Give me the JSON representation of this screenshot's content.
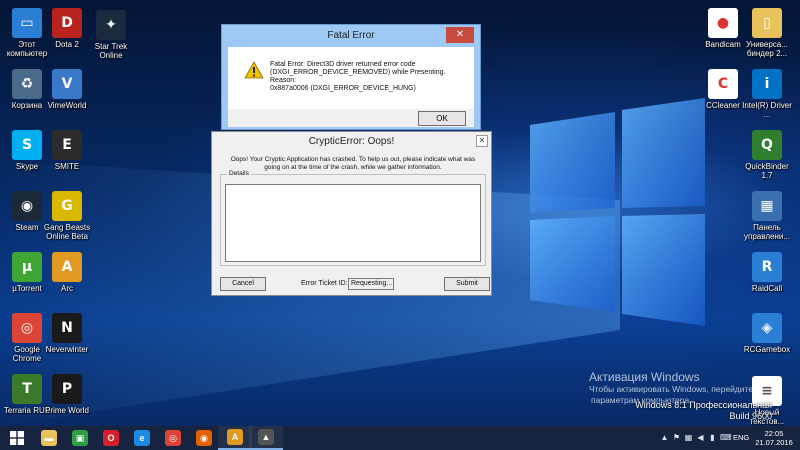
{
  "fatal_dialog": {
    "title": "Fatal Error",
    "message_line1": "Fatal Error: Direct3D driver returned error code",
    "message_line2": "(DXGI_ERROR_DEVICE_REMOVED) while Presenting.  Reason:",
    "message_line3": "0x887a0006 (DXGI_ERROR_DEVICE_HUNG)",
    "ok_label": "OK",
    "close_glyph": "✕"
  },
  "cryptic_dialog": {
    "title": "CrypticError: Oops!",
    "description": "Oops! Your Cryptic Application has crashed. To help us out, please indicate what was going on at the time of the crash, while we gather information.",
    "details_label": "Details",
    "cancel_label": "Cancel",
    "ticket_label": "Error Ticket ID:",
    "ticket_value": "Requesting...",
    "submit_label": "Submit",
    "close_glyph": "✕"
  },
  "desktop_icons_left": [
    {
      "label": "Этот компьютер",
      "icon": "computer-icon",
      "color": "#2a7fd4",
      "glyph": "▭"
    },
    {
      "label": "Корзина",
      "icon": "recycle-bin-icon",
      "color": "#4a6a8a",
      "glyph": "♻"
    },
    {
      "label": "Skype",
      "icon": "skype-icon",
      "color": "#00aff0",
      "glyph": "S"
    },
    {
      "label": "Steam",
      "icon": "steam-icon",
      "color": "#1b2838",
      "glyph": "◉"
    },
    {
      "label": "µTorrent",
      "icon": "utorrent-icon",
      "color": "#3fa535",
      "glyph": "µ"
    },
    {
      "label": "Google Chrome",
      "icon": "chrome-icon",
      "color": "#db4437",
      "glyph": "◎"
    },
    {
      "label": "Terraria RUS",
      "icon": "terraria-icon",
      "color": "#3a7a2a",
      "glyph": "T"
    }
  ],
  "desktop_icons_left2": [
    {
      "label": "Dota 2",
      "icon": "dota2-icon",
      "color": "#b8231d",
      "glyph": "D"
    },
    {
      "label": "VimeWorld",
      "icon": "vimeworld-icon",
      "color": "#3a78c8",
      "glyph": "V"
    },
    {
      "label": "SMITE",
      "icon": "smite-icon",
      "color": "#2b2b2b",
      "glyph": "E"
    },
    {
      "label": "Gang Beasts Online Beta",
      "icon": "gang-beasts-icon",
      "color": "#d8b800",
      "glyph": "G"
    },
    {
      "label": "Arc",
      "icon": "arc-icon",
      "color": "#e09a22",
      "glyph": "A"
    },
    {
      "label": "Neverwinter",
      "icon": "neverwinter-icon",
      "color": "#1a1a1a",
      "glyph": "N"
    },
    {
      "label": "Prime World",
      "icon": "prime-world-icon",
      "color": "#1a1a1a",
      "glyph": "P"
    }
  ],
  "desktop_icon_startrek": {
    "label": "Star Trek Online",
    "icon": "star-trek-online-icon",
    "color": "#1c2a40",
    "glyph": "✦"
  },
  "desktop_icons_right1": [
    {
      "label": "Bandicam",
      "icon": "bandicam-icon",
      "color": "#ffffff",
      "glyph": "●"
    },
    {
      "label": "CCleaner",
      "icon": "ccleaner-icon",
      "color": "#ffffff",
      "glyph": "C"
    }
  ],
  "desktop_icons_right2": [
    {
      "label": "Универса... биндер 2...",
      "icon": "folder-icon",
      "color": "#e8c25a",
      "glyph": "▯"
    },
    {
      "label": "Intel(R) Driver ...",
      "icon": "intel-driver-icon",
      "color": "#0071c5",
      "glyph": "i"
    },
    {
      "label": "QuickBinder 1.7",
      "icon": "quickbinder-icon",
      "color": "#2f7d2f",
      "glyph": "Q"
    },
    {
      "label": "Панель управлени...",
      "icon": "control-panel-icon",
      "color": "#3a6fb0",
      "glyph": "▦"
    },
    {
      "label": "RaidCall",
      "icon": "raidcall-icon",
      "color": "#2a7fd4",
      "glyph": "R"
    },
    {
      "label": "RCGamebox",
      "icon": "rcgamebox-icon",
      "color": "#2a7fd4",
      "glyph": "◈"
    }
  ],
  "desktop_icon_textfile": {
    "label": "Новый текстов...",
    "icon": "text-document-icon",
    "color": "#ffffff",
    "glyph": "≡"
  },
  "activation": {
    "line1": "Активация Windows",
    "line2": "Чтобы активировать Windows, перейдите к",
    "line3": "параметрам компьютера."
  },
  "edition": {
    "line1": "Windows 8.1 Профессиональная",
    "line2": "Build 9600"
  },
  "taskbar": {
    "start_icon": "windows-start-icon",
    "buttons": [
      {
        "name": "file-explorer",
        "icon": "folder-icon",
        "color": "#e8c25a",
        "glyph": "▬",
        "running": false
      },
      {
        "name": "store",
        "icon": "store-icon",
        "color": "#2f9e44",
        "glyph": "▣",
        "running": false
      },
      {
        "name": "opera",
        "icon": "opera-icon",
        "color": "#d61f2a",
        "glyph": "O",
        "running": false
      },
      {
        "name": "internet-explorer",
        "icon": "ie-icon",
        "color": "#1e88e5",
        "glyph": "e",
        "running": false
      },
      {
        "name": "chrome",
        "icon": "chrome-icon",
        "color": "#db4437",
        "glyph": "◎",
        "running": false
      },
      {
        "name": "firefox",
        "icon": "firefox-icon",
        "color": "#e66000",
        "glyph": "◉",
        "running": false
      },
      {
        "name": "arc",
        "icon": "arc-icon",
        "color": "#e09a22",
        "glyph": "A",
        "running": true
      },
      {
        "name": "neverwinter-game",
        "icon": "game-icon",
        "color": "#555555",
        "glyph": "▲",
        "running": true
      }
    ],
    "lang": "ENG",
    "time": "22:05",
    "date": "21.07.2016"
  }
}
